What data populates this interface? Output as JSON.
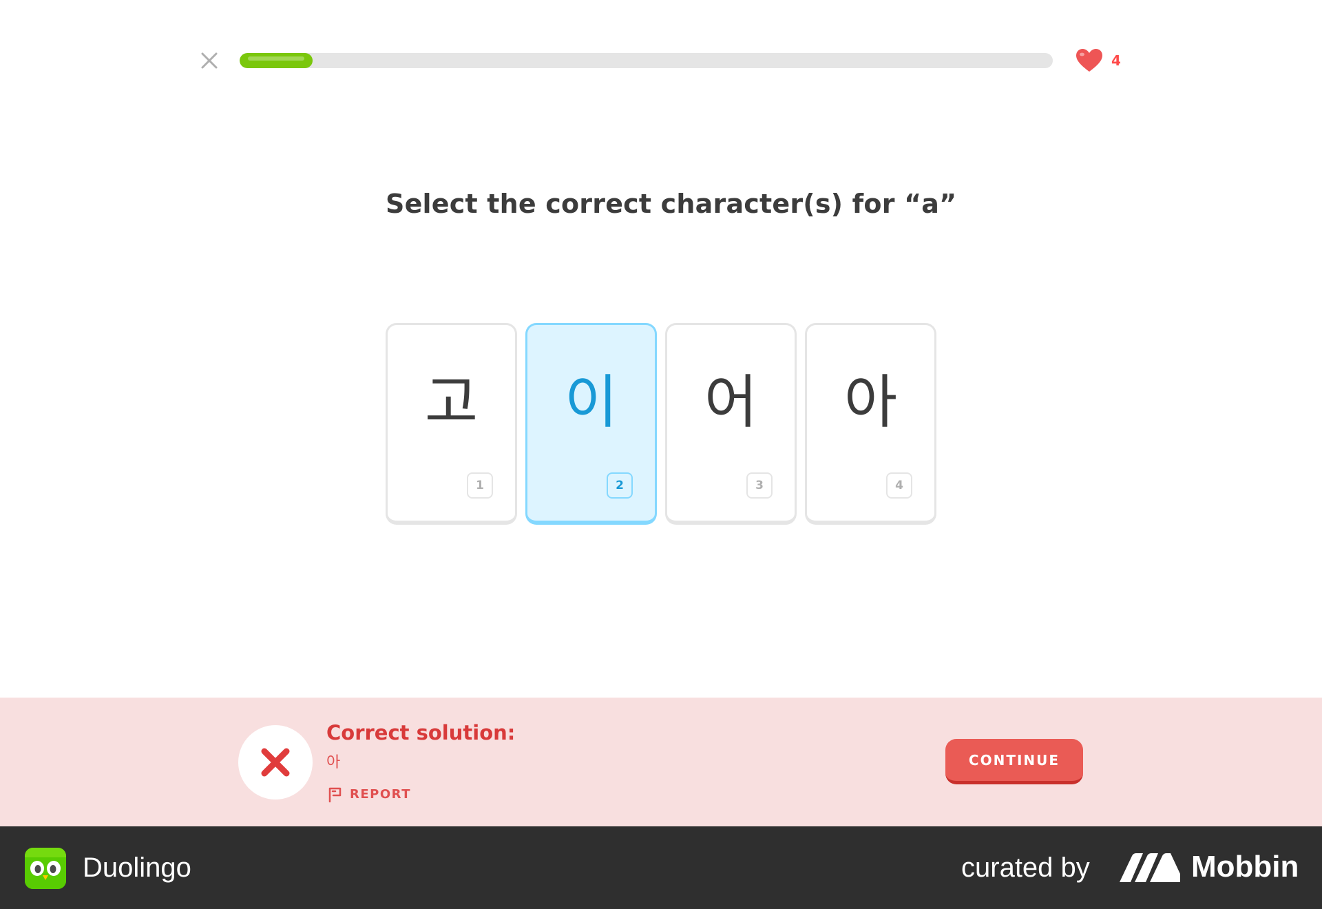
{
  "header": {
    "close_icon": "close-icon",
    "progress_fraction": 0.09,
    "hearts_count": "4",
    "accent_progress": "#7ac70c",
    "accent_heart": "#ff4b4b"
  },
  "question": {
    "text": "Select the correct character(s) for “a”"
  },
  "choices": [
    {
      "char": "고",
      "key": "1",
      "selected": false
    },
    {
      "char": "이",
      "key": "2",
      "selected": true
    },
    {
      "char": "어",
      "key": "3",
      "selected": false
    },
    {
      "char": "아",
      "key": "4",
      "selected": false
    }
  ],
  "feedback": {
    "status": "incorrect",
    "title": "Correct solution:",
    "answer": "아",
    "report_label": "REPORT",
    "continue_label": "CONTINUE",
    "background": "#f8dfdf",
    "accent": "#ea5b55"
  },
  "footer": {
    "app_name": "Duolingo",
    "curated_label": "curated by",
    "brand_name": "Mobbin"
  }
}
